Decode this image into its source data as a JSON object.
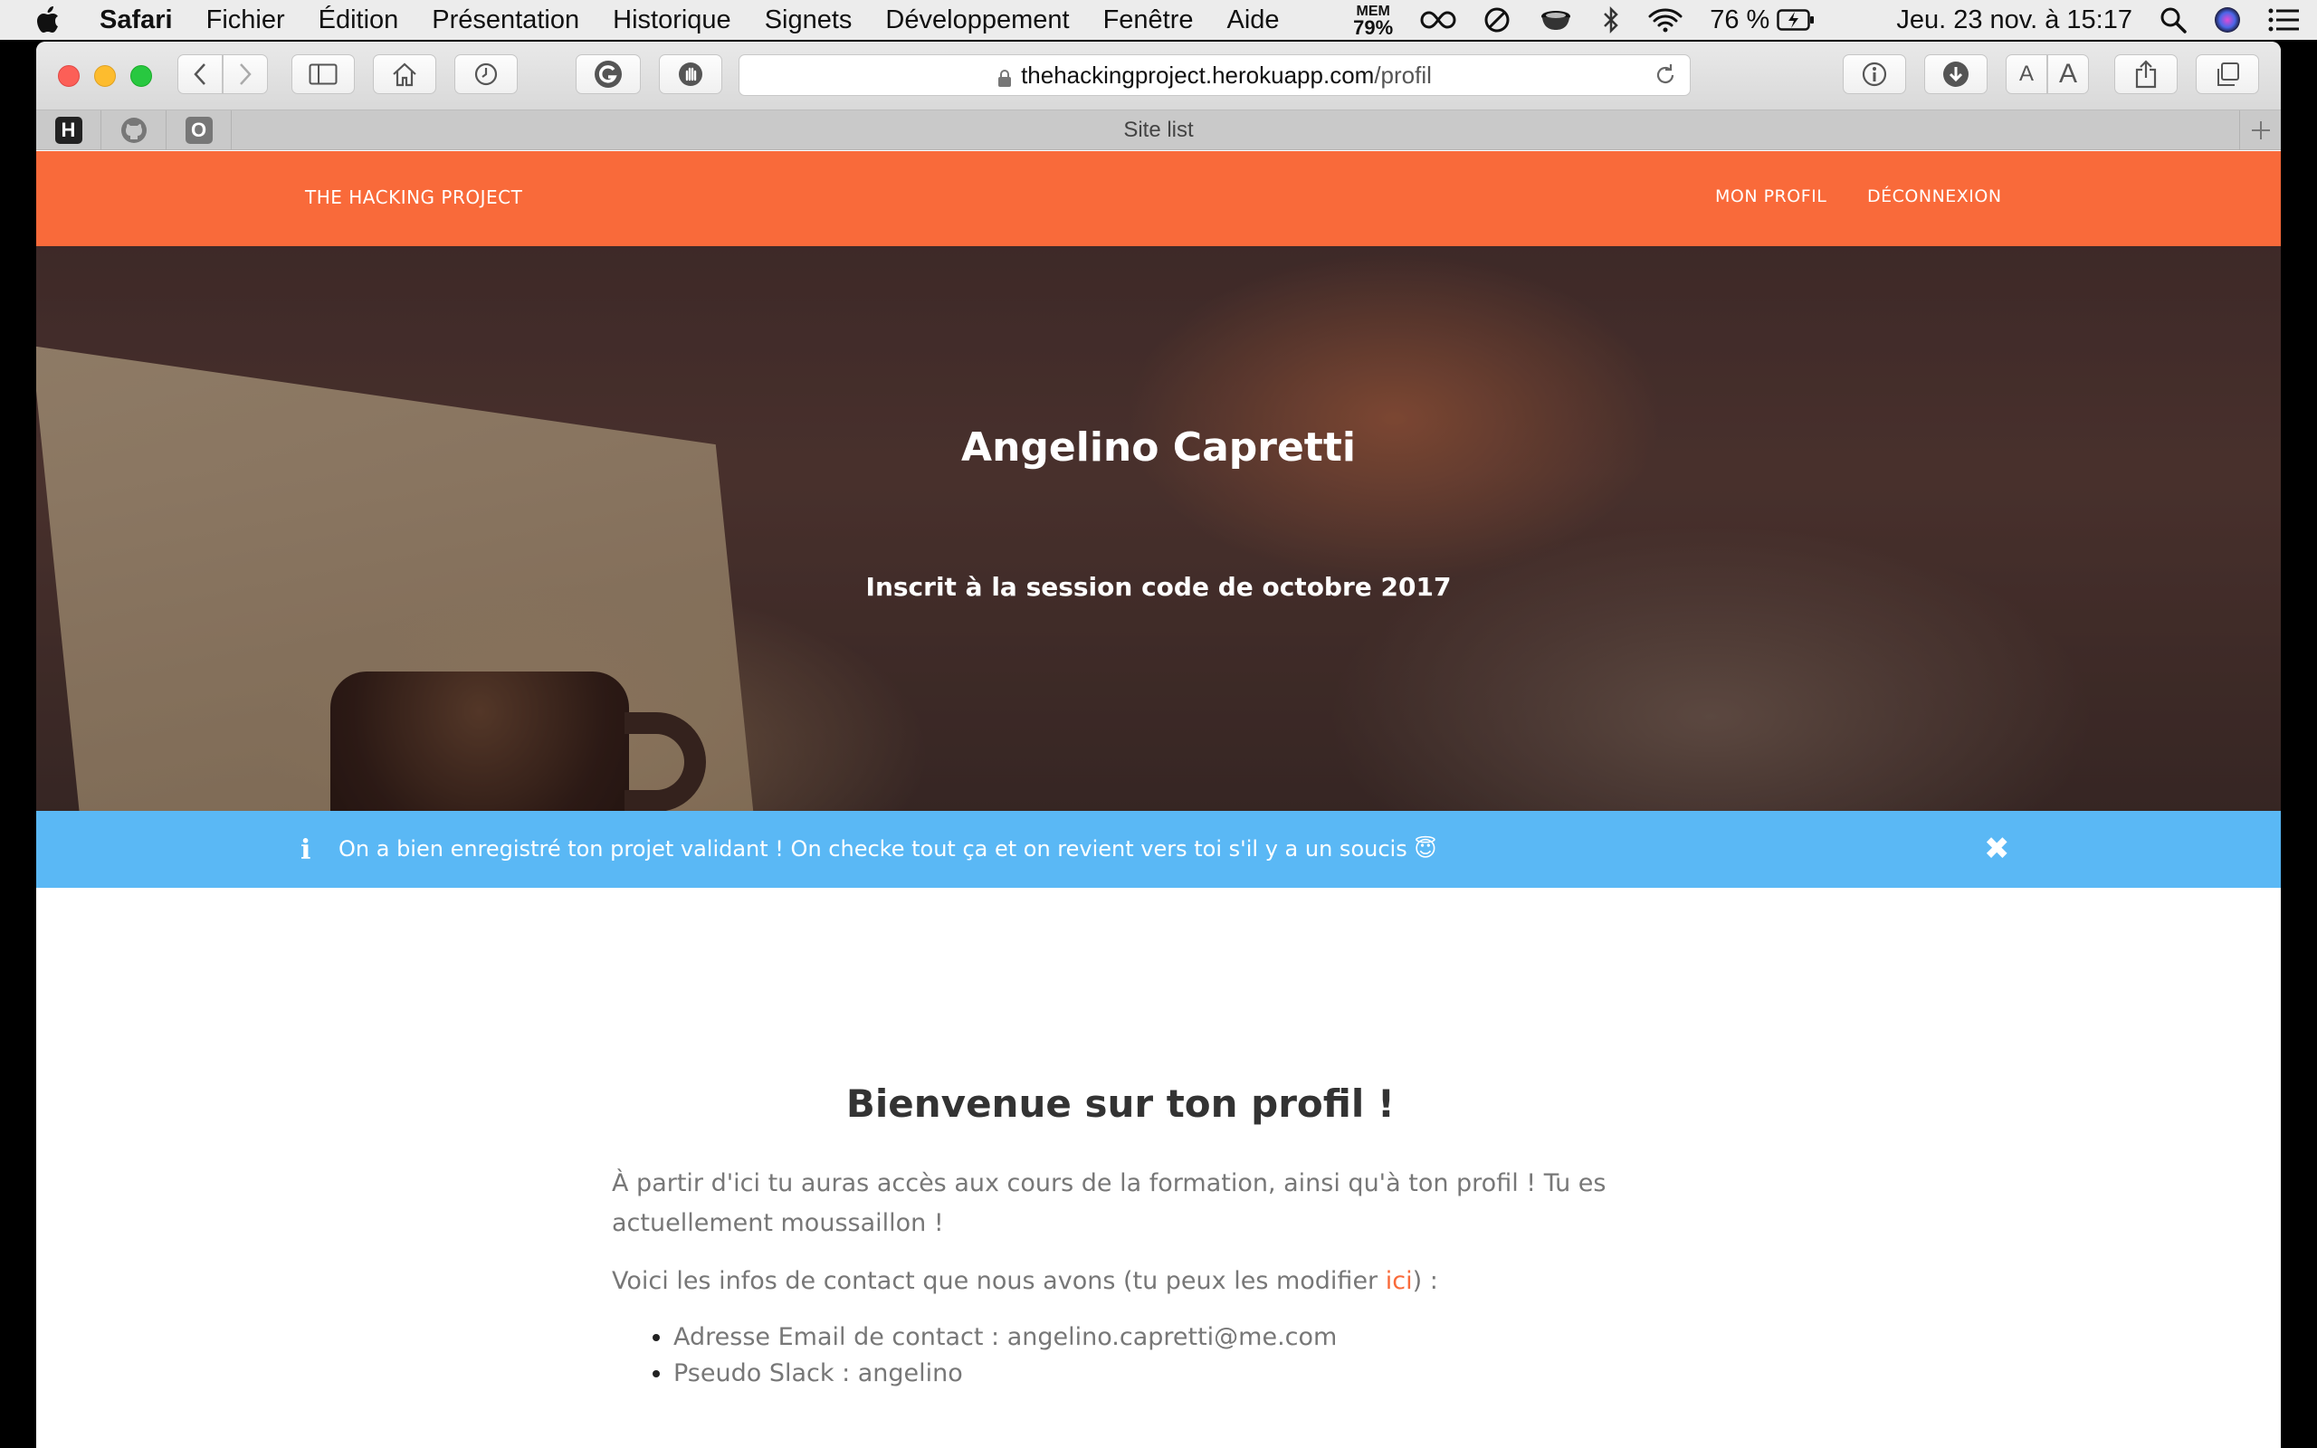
{
  "menubar": {
    "app": "Safari",
    "items": [
      "Fichier",
      "Édition",
      "Présentation",
      "Historique",
      "Signets",
      "Développement",
      "Fenêtre",
      "Aide"
    ],
    "mem_label": "MEM",
    "mem_value": "79%",
    "battery": "76 %",
    "datetime": "Jeu. 23 nov. à  15:17"
  },
  "browser": {
    "url_domain": "thehackingproject.herokuapp.com",
    "url_path": "/profil",
    "tabbar_title": "Site list",
    "favorites": [
      "H",
      "github",
      "O"
    ],
    "font_small": "A",
    "font_large": "A"
  },
  "site": {
    "brand": "THE HACKING PROJECT",
    "nav": [
      "MON PROFIL",
      "DÉCONNEXION"
    ],
    "accent": "#f96a3a",
    "alert_color": "#5ab8f5"
  },
  "hero": {
    "name": "Angelino Capretti",
    "subtitle": "Inscrit à la session code de octobre 2017"
  },
  "alert": {
    "icon": "i",
    "message": "On a bien enregistré ton projet validant ! On checke tout ça et on revient vers toi s'il y a un soucis 😇",
    "close": "✖"
  },
  "content": {
    "title": "Bienvenue sur ton profil !",
    "intro": "À partir d'ici tu auras accès aux cours de la formation, ainsi qu'à ton profil ! Tu es actuellement moussaillon !",
    "contact_before": "Voici les infos de contact que nous avons (tu peux les modifier ",
    "contact_link": "ici",
    "contact_after": ") :",
    "items": [
      "Adresse Email de contact : angelino.capretti@me.com",
      "Pseudo Slack : angelino"
    ]
  }
}
